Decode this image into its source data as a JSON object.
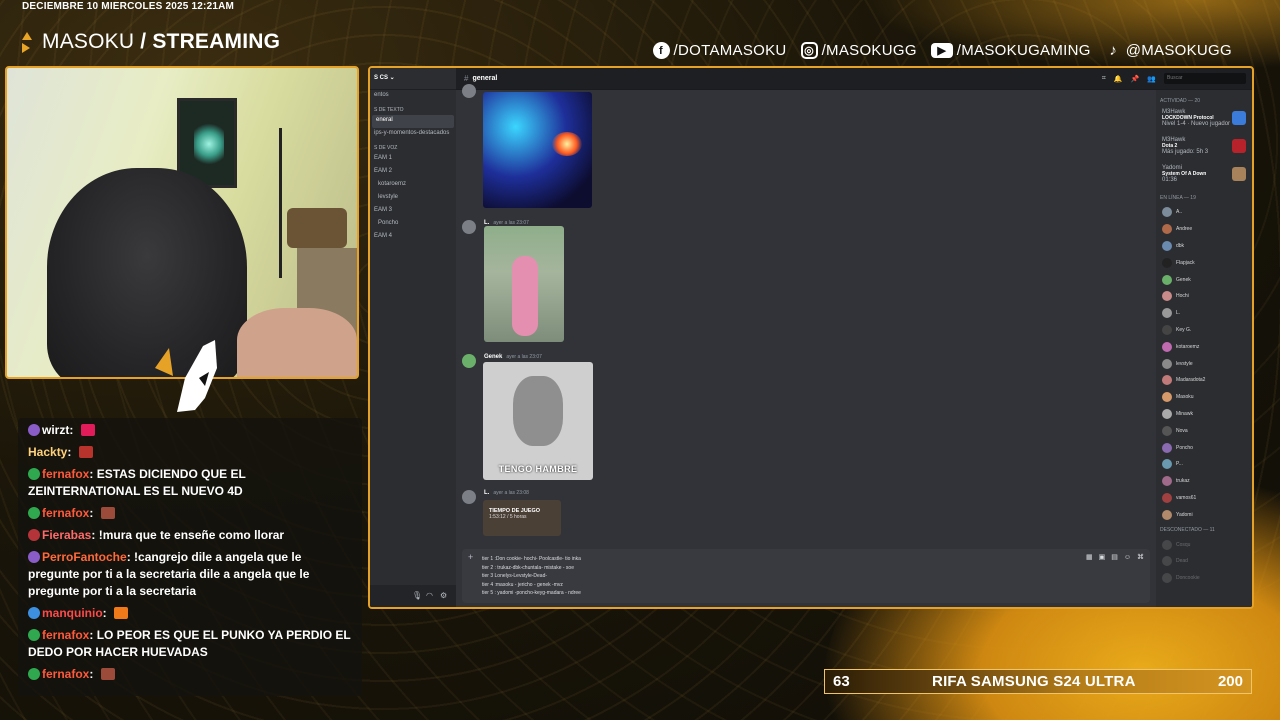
{
  "overlay": {
    "datetime": "DECIEMBRE 10 MIERCOLES 2025 12:21AM",
    "brand_name": "MASOKU",
    "brand_suffix": "/ STREAMING",
    "socials": [
      {
        "icon": "facebook-icon",
        "glyph": "f",
        "handle": "/DOTAMASOKU"
      },
      {
        "icon": "instagram-icon",
        "glyph": "◎",
        "handle": "/MASOKUGG"
      },
      {
        "icon": "youtube-icon",
        "glyph": "▶",
        "handle": "/MASOKUGAMING"
      },
      {
        "icon": "tiktok-icon",
        "glyph": "♪",
        "handle": "@MASOKUGG"
      }
    ],
    "raffle": {
      "left": "63",
      "title": "RIFA SAMSUNG S24 ULTRA",
      "right": "200"
    },
    "accent": "#e6a227"
  },
  "chat": [
    {
      "user": "wirzt",
      "color": "#ffffff",
      "text": "",
      "badge": "#8a5cc7",
      "emote": "#e21c5a"
    },
    {
      "user": "Hackty",
      "color": "#ffd27a",
      "text": "",
      "badge": "",
      "emote": "#b8332b"
    },
    {
      "user": "fernafox",
      "color": "#ff5a3c",
      "text": "ESTAS DICIENDO QUE EL ZEINTERNATIONAL ES EL NUEVO 4D",
      "badge": "#2fa84f",
      "emote": ""
    },
    {
      "user": "fernafox",
      "color": "#ff5a3c",
      "text": "",
      "badge": "#2fa84f",
      "emote": "#9c4b3a"
    },
    {
      "user": "Fierabas",
      "color": "#ff6a6a",
      "text": "!mura que te enseñe como llorar",
      "badge": "#b5343a",
      "emote": ""
    },
    {
      "user": "PerroFantoche",
      "color": "#ff6a3c",
      "text": "!cangrejo dile a angela que le pregunte por ti a la secretaria dile a angela que le pregunte por ti a la secretaria",
      "badge": "#8a5cc7",
      "emote": ""
    },
    {
      "user": "manquinio",
      "color": "#ff4a4a",
      "text": "",
      "badge": "#3d8fe0",
      "emote": "#f07a1a"
    },
    {
      "user": "fernafox",
      "color": "#ff5a3c",
      "text": "LO PEOR ES QUE EL PUNKO YA PERDIO EL DEDO POR HACER HUEVADAS",
      "badge": "#2fa84f",
      "emote": ""
    },
    {
      "user": "fernafox",
      "color": "#ff5a3c",
      "text": "",
      "badge": "#2fa84f",
      "emote": "#9c4b3a"
    }
  ],
  "discord": {
    "server": "S CS",
    "sidebar": {
      "events": "entos",
      "cat_text": "s de texto",
      "channels": [
        "eneral",
        "ips-y-momentos-destacados"
      ],
      "cat_voice": "s de voz",
      "voice": [
        {
          "name": "EAM 1",
          "users": []
        },
        {
          "name": "EAM 2",
          "users": [
            "kotaroemz",
            "levstyle"
          ]
        },
        {
          "name": "EAM 3",
          "users": [
            "Poncho"
          ]
        },
        {
          "name": "EAM 4",
          "users": []
        }
      ]
    },
    "channel": "general",
    "search_placeholder": "Buscar",
    "messages": [
      {
        "author": "",
        "time": "",
        "media": "gif1"
      },
      {
        "author": "L.",
        "time": "ayer a las 23:07",
        "media": "gif2"
      },
      {
        "author": "Genek",
        "time": "ayer a las 23:07",
        "media": "gif3",
        "caption": "TENGO HAMBRE"
      },
      {
        "author": "L.",
        "time": "ayer a las 23:08",
        "media": "card",
        "card_title": "TIEMPO DE JUEGO",
        "card_sub": "1:53:12 / 5 horas"
      }
    ],
    "composer_lines": [
      "tier 1 :Don cookie- hochi- Poolcastle- tio inka",
      "tier 2 : trukaz-dbk-chuntala- mistake - soe",
      "tier 3 Lonelys-Levstyle-Dead-",
      "tier 4 :masoku - jericho - genek -mvz",
      "tier 5 : yadomi -poncho-keyg-madara - ndree"
    ],
    "members": {
      "activity_header": "Actividad — 20",
      "activities": [
        {
          "user": "M3Hawk",
          "title": "LOCKDOWN Protocol",
          "sub": "Nivel 1-4 · Nuevo jugador",
          "color": "#3b7bd9"
        },
        {
          "user": "M3Hawk",
          "title": "Dota 2",
          "sub": "Más jugado: 5h 3",
          "color": "#b8232b"
        },
        {
          "user": "Yadomi",
          "title": "System Of A Down",
          "sub": "01:36",
          "color": "#a8825a"
        }
      ],
      "online_header": "En línea — 19",
      "online": [
        {
          "name": "A..",
          "color": "#7d8c9a"
        },
        {
          "name": "Andree",
          "color": "#b06a4a"
        },
        {
          "name": "dbk",
          "color": "#6a8ab0"
        },
        {
          "name": "Flapjack",
          "color": "#222222"
        },
        {
          "name": "Genek",
          "color": "#6ab06a"
        },
        {
          "name": "Hochi",
          "color": "#c98a8a"
        },
        {
          "name": "L.",
          "color": "#999999"
        },
        {
          "name": "Key G.",
          "color": "#444444"
        },
        {
          "name": "kotaroemz",
          "color": "#c06ab0"
        },
        {
          "name": "levstyle",
          "color": "#8a8a8a"
        },
        {
          "name": "Madaradota2",
          "color": "#c07a7a"
        },
        {
          "name": "Masoku",
          "color": "#d69a6a"
        },
        {
          "name": "Minawk",
          "color": "#aaaaaa"
        },
        {
          "name": "Nova",
          "color": "#555555"
        },
        {
          "name": "Poncho",
          "color": "#8a6ab0"
        },
        {
          "name": "P...",
          "color": "#6a9ab0"
        },
        {
          "name": "trukaz",
          "color": "#a06a8a"
        },
        {
          "name": "vamos61",
          "color": "#a04040"
        },
        {
          "name": "Yadomi",
          "color": "#b08a6a"
        }
      ],
      "offline_header": "Desconectado — 11",
      "offline": [
        {
          "name": "Cosqu",
          "color": "#777777"
        },
        {
          "name": "Dead",
          "color": "#777777"
        },
        {
          "name": "Doncookie",
          "color": "#777777"
        }
      ]
    }
  }
}
